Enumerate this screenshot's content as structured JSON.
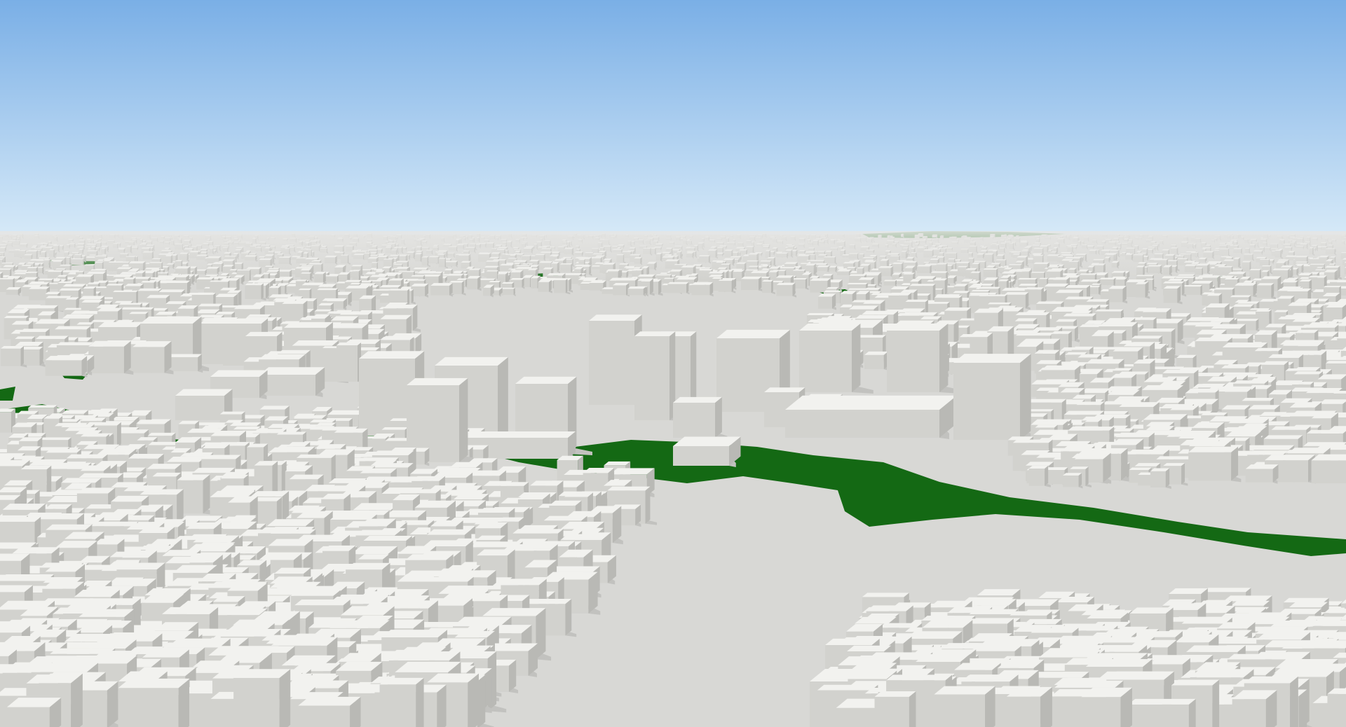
{
  "scene": {
    "subject": "3d-city-model",
    "colors": {
      "sky_top": "#7aafe6",
      "sky_horizon": "#d9ebf8",
      "ground": "#d8d8d5",
      "park": "#146914",
      "building_top": "#f2f2ef",
      "building_left": "#d2d2ce",
      "building_right": "#b9b9b5",
      "shadow": "#c2c2bf",
      "haze": "#e3e3e0"
    }
  }
}
